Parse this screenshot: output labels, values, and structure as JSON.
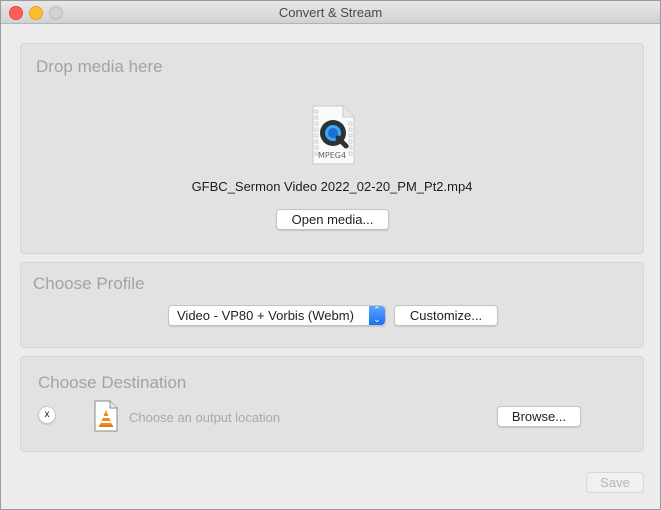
{
  "window": {
    "title": "Convert & Stream",
    "traffic_lights": [
      "close",
      "minimize",
      "maximize-disabled"
    ]
  },
  "drop_panel": {
    "title": "Drop media here",
    "file_icon": "mpeg4-file-icon",
    "file_icon_label": "MPEG4",
    "file_name": "GFBC_Sermon Video 2022_02-20_PM_Pt2.mp4",
    "open_button": "Open media..."
  },
  "profile_panel": {
    "title": "Choose Profile",
    "selected_profile": "Video - VP80 + Vorbis (Webm)",
    "customize_button": "Customize..."
  },
  "destination_panel": {
    "title": "Choose Destination",
    "clear_button": "x",
    "file_icon": "vlc-file-icon",
    "placeholder": "Choose an output location",
    "browse_button": "Browse..."
  },
  "footer": {
    "save_button": "Save"
  }
}
